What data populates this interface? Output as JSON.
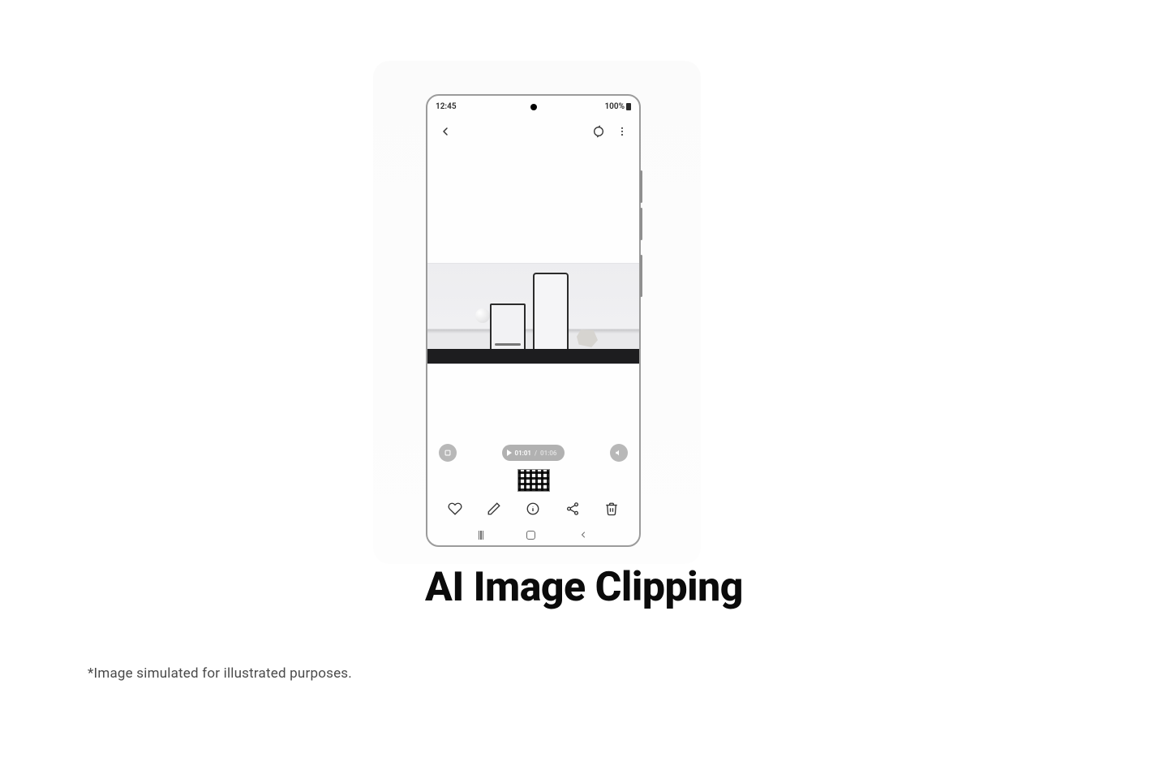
{
  "status": {
    "time": "12:45",
    "battery": "100%"
  },
  "player": {
    "current": "01:01",
    "sep": " / ",
    "total": "01:06"
  },
  "feature_title": "AI Image Clipping",
  "disclaimer": "*Image simulated for illustrated purposes."
}
